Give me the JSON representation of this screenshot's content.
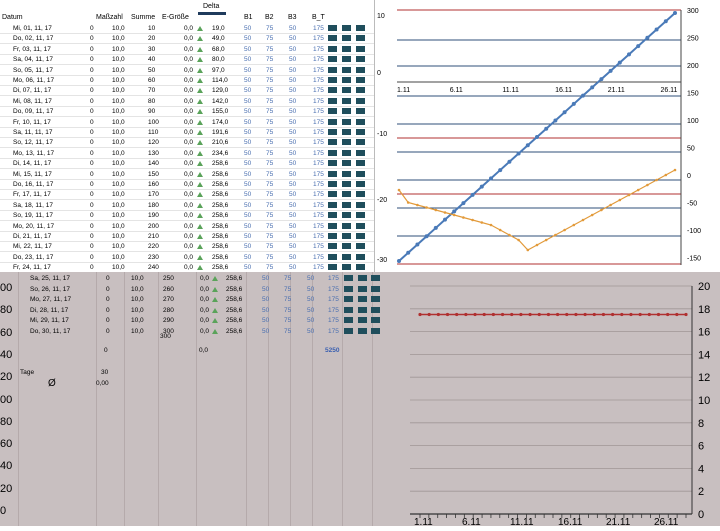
{
  "headers": {
    "datum": "Datum",
    "masszahl": "Maßzahl",
    "summe": "Summe",
    "egroesse": "E-Größe",
    "delta": "Delta",
    "b1": "B1",
    "b2": "B2",
    "b3": "B3",
    "bt": "B_T"
  },
  "rows": [
    {
      "d": "Mi, 01, 11, 17",
      "z": "0",
      "m": "10,0",
      "s": "10",
      "e": "0,0",
      "v": "19,0"
    },
    {
      "d": "Do, 02, 11, 17",
      "z": "0",
      "m": "10,0",
      "s": "20",
      "e": "0,0",
      "v": "49,0"
    },
    {
      "d": "Fr, 03, 11, 17",
      "z": "0",
      "m": "10,0",
      "s": "30",
      "e": "0,0",
      "v": "68,0"
    },
    {
      "d": "Sa, 04, 11, 17",
      "z": "0",
      "m": "10,0",
      "s": "40",
      "e": "0,0",
      "v": "80,0"
    },
    {
      "d": "So, 05, 11, 17",
      "z": "0",
      "m": "10,0",
      "s": "50",
      "e": "0,0",
      "v": "97,0"
    },
    {
      "d": "Mo, 06, 11, 17",
      "z": "0",
      "m": "10,0",
      "s": "60",
      "e": "0,0",
      "v": "114,0"
    },
    {
      "d": "Di, 07, 11, 17",
      "z": "0",
      "m": "10,0",
      "s": "70",
      "e": "0,0",
      "v": "129,0"
    },
    {
      "d": "Mi, 08, 11, 17",
      "z": "0",
      "m": "10,0",
      "s": "80",
      "e": "0,0",
      "v": "142,0"
    },
    {
      "d": "Do, 09, 11, 17",
      "z": "0",
      "m": "10,0",
      "s": "90",
      "e": "0,0",
      "v": "155,0"
    },
    {
      "d": "Fr, 10, 11, 17",
      "z": "0",
      "m": "10,0",
      "s": "100",
      "e": "0,0",
      "v": "174,0"
    },
    {
      "d": "Sa, 11, 11, 17",
      "z": "0",
      "m": "10,0",
      "s": "110",
      "e": "0,0",
      "v": "191,6"
    },
    {
      "d": "So, 12, 11, 17",
      "z": "0",
      "m": "10,0",
      "s": "120",
      "e": "0,0",
      "v": "210,6"
    },
    {
      "d": "Mo, 13, 11, 17",
      "z": "0",
      "m": "10,0",
      "s": "130",
      "e": "0,0",
      "v": "234,6"
    },
    {
      "d": "Di, 14, 11, 17",
      "z": "0",
      "m": "10,0",
      "s": "140",
      "e": "0,0",
      "v": "258,6"
    },
    {
      "d": "Mi, 15, 11, 17",
      "z": "0",
      "m": "10,0",
      "s": "150",
      "e": "0,0",
      "v": "258,6"
    },
    {
      "d": "Do, 16, 11, 17",
      "z": "0",
      "m": "10,0",
      "s": "160",
      "e": "0,0",
      "v": "258,6"
    },
    {
      "d": "Fr, 17, 11, 17",
      "z": "0",
      "m": "10,0",
      "s": "170",
      "e": "0,0",
      "v": "258,6"
    },
    {
      "d": "Sa, 18, 11, 17",
      "z": "0",
      "m": "10,0",
      "s": "180",
      "e": "0,0",
      "v": "258,6"
    },
    {
      "d": "So, 19, 11, 17",
      "z": "0",
      "m": "10,0",
      "s": "190",
      "e": "0,0",
      "v": "258,6"
    },
    {
      "d": "Mo, 20, 11, 17",
      "z": "0",
      "m": "10,0",
      "s": "200",
      "e": "0,0",
      "v": "258,6"
    },
    {
      "d": "Di, 21, 11, 17",
      "z": "0",
      "m": "10,0",
      "s": "210",
      "e": "0,0",
      "v": "258,6"
    },
    {
      "d": "Mi, 22, 11, 17",
      "z": "0",
      "m": "10,0",
      "s": "220",
      "e": "0,0",
      "v": "258,6"
    },
    {
      "d": "Do, 23, 11, 17",
      "z": "0",
      "m": "10,0",
      "s": "230",
      "e": "0,0",
      "v": "258,6"
    },
    {
      "d": "Fr, 24, 11, 17",
      "z": "0",
      "m": "10,0",
      "s": "240",
      "e": "0,0",
      "v": "258,6"
    }
  ],
  "b_values": {
    "b1": "50",
    "b2": "75",
    "b3": "50",
    "bt": "175"
  },
  "lower_rows": [
    {
      "d": "Sa, 25, 11, 17",
      "z": "0",
      "m": "10,0",
      "s": "250",
      "e": "0,0",
      "v": "258,6"
    },
    {
      "d": "So, 26, 11, 17",
      "z": "0",
      "m": "10,0",
      "s": "260",
      "e": "0,0",
      "v": "258,6"
    },
    {
      "d": "Mo, 27, 11, 17",
      "z": "0",
      "m": "10,0",
      "s": "270",
      "e": "0,0",
      "v": "258,6"
    },
    {
      "d": "Di, 28, 11, 17",
      "z": "0",
      "m": "10,0",
      "s": "280",
      "e": "0,0",
      "v": "258,6"
    },
    {
      "d": "Mi, 29, 11, 17",
      "z": "0",
      "m": "10,0",
      "s": "290",
      "e": "0,0",
      "v": "258,6"
    },
    {
      "d": "Do, 30, 11, 17",
      "z": "0",
      "m": "10,0",
      "s": "300",
      "e": "0,0",
      "v": "258,6"
    }
  ],
  "summary": {
    "total_summe": "300",
    "sum_z": "0",
    "sum_e": "0,0",
    "sum_bt": "5250",
    "tage_label": "Tage",
    "tage_value": "30",
    "avg_symbol": "Ø",
    "avg_value": "0,00"
  },
  "left_axis_ticks": [
    "00",
    "80",
    "60",
    "40",
    "20",
    "00",
    "80",
    "60",
    "40",
    "20",
    "0"
  ],
  "chart_top": {
    "type": "line",
    "x_ticks": [
      "1.11",
      "6.11",
      "11.11",
      "16.11",
      "21.11",
      "26.11"
    ],
    "left_axis": [
      "10",
      "0",
      "-10",
      "-20",
      "-30"
    ],
    "right_axis": [
      "300",
      "250",
      "200",
      "150",
      "100",
      "50",
      "0",
      "-50",
      "-100",
      "-150"
    ],
    "series": [
      {
        "color": "#4a7ab8",
        "values": [
          -150,
          -135,
          -120,
          -105,
          -90,
          -75,
          -60,
          -45,
          -30,
          -15,
          0,
          15,
          30,
          45,
          60,
          75,
          90,
          105,
          120,
          135,
          150,
          165,
          180,
          195,
          210,
          225,
          240,
          255,
          270,
          285,
          300
        ]
      },
      {
        "color": "#e29a3a",
        "values": [
          -10,
          -35,
          -40,
          -45,
          -50,
          -55,
          -60,
          -65,
          -70,
          -75,
          -80,
          -90,
          -100,
          -110,
          -130,
          -120,
          -110,
          -100,
          -90,
          -80,
          -70,
          -60,
          -50,
          -40,
          -30,
          -20,
          -10,
          0,
          10,
          20,
          30
        ]
      }
    ]
  },
  "chart_bottom": {
    "type": "line",
    "x_ticks": [
      "1.11",
      "6.11",
      "11.11",
      "16.11",
      "21.11",
      "26.11"
    ],
    "y_ticks": [
      "20",
      "18",
      "16",
      "14",
      "12",
      "10",
      "8",
      "6",
      "4",
      "2",
      "0"
    ],
    "ylim": [
      0,
      20
    ],
    "series": [
      {
        "color": "#b03030",
        "value": 17.5,
        "count": 30
      }
    ]
  }
}
